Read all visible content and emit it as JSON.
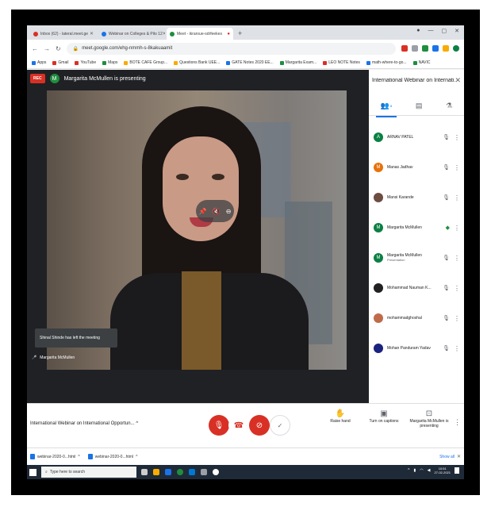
{
  "browser": {
    "tabs": [
      {
        "label": "Inbox (62) - lateral.meet.ge",
        "color": "#d93025"
      },
      {
        "label": "Webinar on Colleges & Pilo 12",
        "color": "#1a73e8"
      },
      {
        "label": "Meet - ikraroue-sdrfeekes",
        "color": "#1e8e3e",
        "active": true
      }
    ],
    "new_tab": "+",
    "url": "meet.google.com/ehg-nmmh-s-8kakuaamit",
    "bookmarks": [
      {
        "label": "Apps",
        "color": "#1a73e8"
      },
      {
        "label": "Gmail",
        "color": "#d93025"
      },
      {
        "label": "YouTube",
        "color": "#d93025"
      },
      {
        "label": "Maps",
        "color": "#1e8e3e"
      },
      {
        "label": "BOTE CAFE Group...",
        "color": "#f9ab00"
      },
      {
        "label": "Questions Bank UEE...",
        "color": "#f9ab00"
      },
      {
        "label": "GATE Notes 2020 EE...",
        "color": "#1a73e8"
      },
      {
        "label": "Margarita Exam...",
        "color": "#1e8e3e"
      },
      {
        "label": "LEO NOTE Notes",
        "color": "#d93025"
      },
      {
        "label": "math-where-to-go...",
        "color": "#1a73e8"
      },
      {
        "label": "NAVIC",
        "color": "#1e8e3e"
      }
    ]
  },
  "meeting": {
    "rec_label": "REC",
    "presenter_initial": "M",
    "presenting_text": "Margarita McMullen is presenting",
    "toast_text": "Shinal Shinde has left the meeting",
    "self_name": "Margarita McMullen",
    "title": "International Webinar on International Opportun..."
  },
  "panel": {
    "title": "International Webinar on Internati...",
    "people_count": "8",
    "participants": [
      {
        "name": "ARNAV PATEL",
        "sub": "",
        "initial": "A",
        "color": "#0b8043"
      },
      {
        "name": "Manas Jadhav",
        "sub": "",
        "initial": "M",
        "color": "#e8710a"
      },
      {
        "name": "Mansi Karande",
        "sub": "",
        "initial": "",
        "color": "#6d4c41"
      },
      {
        "name": "Margarita McMullen",
        "sub": "",
        "initial": "M",
        "color": "#0b8043"
      },
      {
        "name": "Margarita McMullen",
        "sub": "Presentation",
        "initial": "M",
        "color": "#0b8043"
      },
      {
        "name": "Mohammad Nauman K...",
        "sub": "",
        "initial": "",
        "color": "#212121"
      },
      {
        "name": "mohammadghoshal",
        "sub": "",
        "initial": "",
        "color": "#bf6b4a"
      },
      {
        "name": "Mohan Panduram Yadav",
        "sub": "",
        "initial": "",
        "color": "#1a237e"
      }
    ]
  },
  "bottom": {
    "raise_hand": "Raise hand",
    "captions": "Turn on captions",
    "presenting": "Margarita McMullen is presenting"
  },
  "downloads": {
    "items": [
      "webinar-2020-0...html",
      "webinar-2020-0...html"
    ],
    "show_all": "Show all"
  },
  "taskbar": {
    "search_placeholder": "Type here to search",
    "time": "10:51",
    "date": "27-02-2021"
  }
}
